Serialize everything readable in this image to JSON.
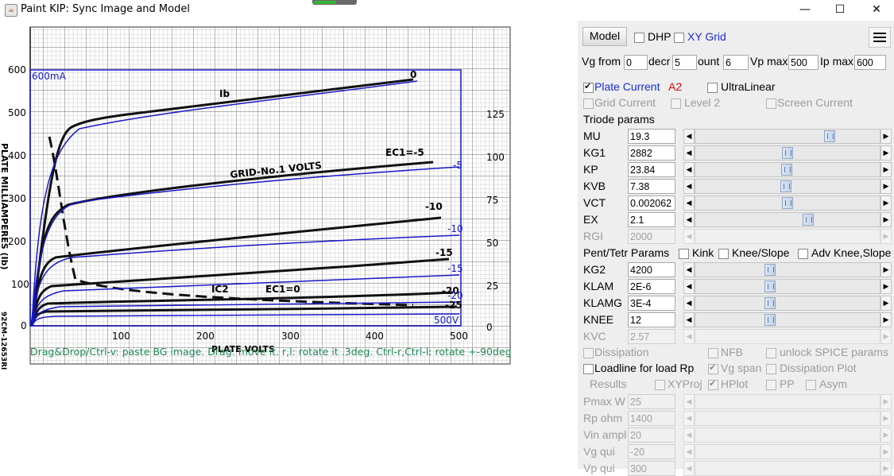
{
  "window": {
    "title": "Paint KIP: Sync Image and Model",
    "app_icon": "java-cup-icon",
    "controls": {
      "minimize": "—",
      "maximize": "☐",
      "close": "✕"
    }
  },
  "canvas": {
    "hint": "Drag&Drop/Ctrl-v: paste BG image. Drag: move it. r,l: rotate it .3deg. Ctrl-r,Ctrl-l: rotate +-90deg",
    "model_ip_max_label": "600mA",
    "model_vp_max_label": "500V",
    "image": {
      "y_axis_title": "PLATE MILLIAMPERES (Ib)",
      "x_axis_title": "PLATE VOLTS",
      "y_ticks": [
        "600",
        "500",
        "400",
        "300",
        "200",
        "100",
        "0"
      ],
      "x_ticks": [
        "100",
        "200",
        "300",
        "400",
        "500"
      ],
      "right_ticks": [
        "125",
        "100",
        "75",
        "50",
        "25",
        "0"
      ],
      "curve_labels": [
        "0",
        "-5",
        "-10",
        "-15",
        "-20",
        "-25"
      ],
      "model_curve_labels": [
        "0",
        "-5",
        "-10",
        "-15",
        "-20",
        "-25"
      ],
      "annotation_grid": "GRID-No.1 VOLTS",
      "annotation_ib": "Ib",
      "annotation_ec1_eq": "EC1=-5",
      "annotation_ic2": "IC2",
      "annotation_ec1_zero": "EC1=0",
      "stamp": "92CM-12653RI"
    }
  },
  "panel": {
    "toolbar": {
      "model_label": "Model",
      "dhp_label": "DHP",
      "dhp_checked": false,
      "xygrid_label": "XY Grid",
      "xygrid_checked": false,
      "menu_icon": "hamburger-menu-icon"
    },
    "range": {
      "vg_from_label": "Vg from",
      "vg_from_value": "0",
      "decr_label": "decr",
      "decr_value": "5",
      "count_label": "ount",
      "count_value": "6",
      "vp_max_label": "Vp max",
      "vp_max_value": "500",
      "ip_max_label": "Ip max",
      "ip_max_value": "600"
    },
    "options": {
      "plate_current_label": "Plate Current",
      "plate_current_checked": true,
      "tube_name": "A2",
      "ultralinear_label": "UltraLinear",
      "ultralinear_checked": false,
      "grid_current_label": "Grid Current",
      "level2_label": "Level 2",
      "screen_current_label": "Screen Current"
    },
    "triode": {
      "heading": "Triode params",
      "params": [
        {
          "name": "MU",
          "value": "19.3",
          "slider": 0.73
        },
        {
          "name": "KG1",
          "value": "2882",
          "slider": 0.5
        },
        {
          "name": "KP",
          "value": "23.84",
          "slider": 0.495
        },
        {
          "name": "KVB",
          "value": "7.38",
          "slider": 0.49
        },
        {
          "name": "VCT",
          "value": "0.002062",
          "slider": 0.5
        },
        {
          "name": "EX",
          "value": "2.1",
          "slider": 0.61
        },
        {
          "name": "RGI",
          "value": "2000",
          "slider": null,
          "disabled": true
        }
      ]
    },
    "pent": {
      "heading": "Pent/Tetr Params",
      "kink_label": "Kink",
      "knee_slope_label": "Knee/Slope",
      "adv_knee_label": "Adv Knee,Slope",
      "params": [
        {
          "name": "KG2",
          "value": "4200",
          "slider": 0.405
        },
        {
          "name": "KLAM",
          "value": "2E-6",
          "slider": 0.405
        },
        {
          "name": "KLAMG",
          "value": "3E-4",
          "slider": 0.405
        },
        {
          "name": "KNEE",
          "value": "12",
          "slider": 0.405
        },
        {
          "name": "KVC",
          "value": "2.57",
          "slider": null,
          "disabled": true
        }
      ]
    },
    "misc": {
      "dissipation_label": "Dissipation",
      "nfb_label": "NFB",
      "unlock_spice_label": "unlock SPICE params",
      "loadline_label": "Loadline for load Rp",
      "vg_span_label": "Vg span",
      "vg_span_checked": true,
      "dissipation_plot_label": "Dissipation Plot",
      "results_label": "Results",
      "xyproj_label": "XYProj",
      "hplot_label": "HPlot",
      "hplot_checked": true,
      "pp_label": "PP",
      "asym_label": "Asym"
    },
    "results": [
      {
        "name": "Pmax W",
        "value": "25"
      },
      {
        "name": "Rp ohm",
        "value": "1400"
      },
      {
        "name": "Vin ampl",
        "value": "20"
      },
      {
        "name": "Vg qui",
        "value": "-20"
      },
      {
        "name": "Vp qui",
        "value": "300"
      }
    ]
  }
}
